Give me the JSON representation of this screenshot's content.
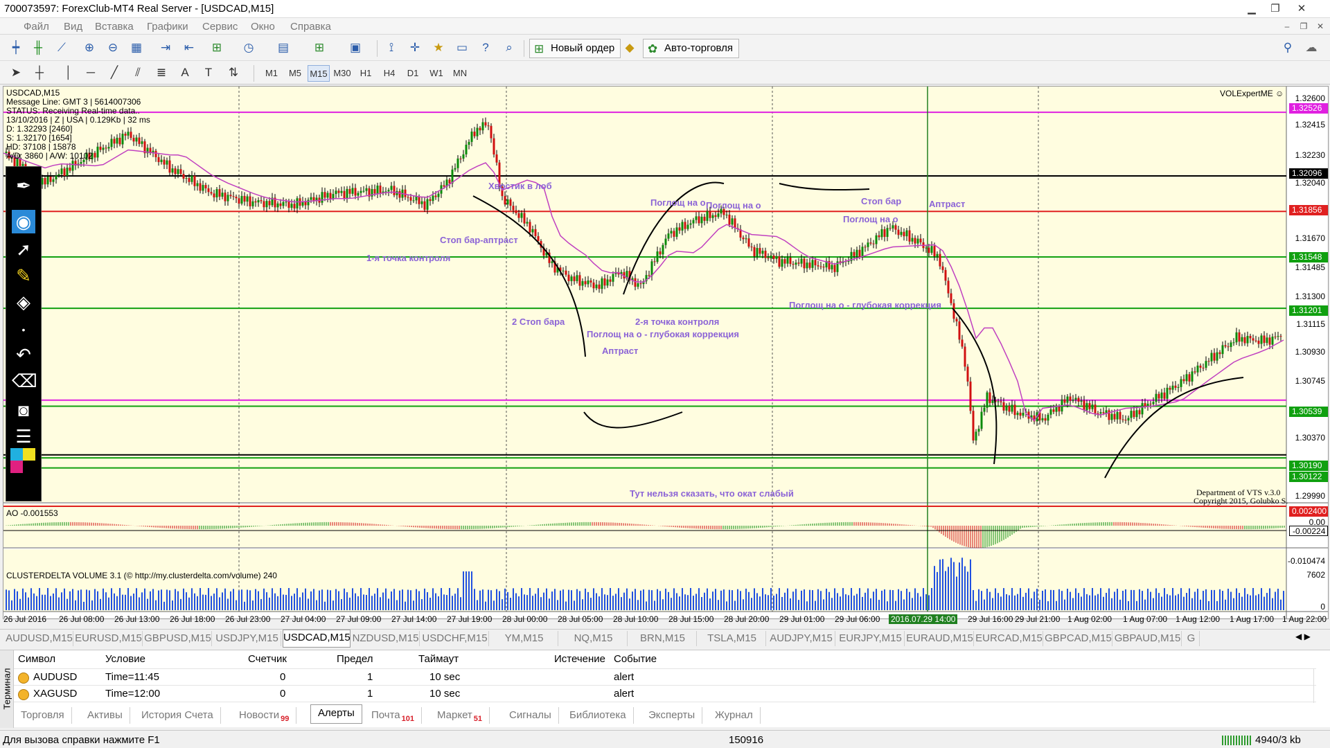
{
  "window": {
    "title": "700073597: ForexClub-MT4 Real Server - [USDCAD,M15]"
  },
  "menu": [
    "Файл",
    "Вид",
    "Вставка",
    "Графики",
    "Сервис",
    "Окно",
    "Справка"
  ],
  "toolbar": {
    "new_order": "Новый ордер",
    "auto_trading": "Авто-торговля"
  },
  "timeframes": [
    "M1",
    "M5",
    "M15",
    "M30",
    "H1",
    "H4",
    "D1",
    "W1",
    "MN"
  ],
  "active_timeframe": "M15",
  "chart": {
    "symbol_line": "USDCAD,M15",
    "message_line": "Message Line: GMT 3  |  5614007306",
    "status_line": "STATUS:  Receiving Real-time data..",
    "info_line": "13/10/2016 | Z | USA | 0.129Kb | 32 ms",
    "d_line": "D: 1.32293  [2460]",
    "s_line": "S: 1.32170  [1654]",
    "hd_line": "HD: 37108 | 15878",
    "ad_line": "A/D: 3860 | A/W: 10102",
    "indicator_title": "VOLExpertME ☺",
    "ao_label": "AO -0.001553",
    "cluster_label": "CLUSTERDELTA VOLUME 3.1 (© http://my.clusterdelta.com/volume) 240",
    "copyright_line1": "Department of VTS  v.3.0",
    "copyright_line2": "Copyright 2015, Golubko S.",
    "price_scale": [
      "1.32600",
      "1.32415",
      "1.32230",
      "1.32040",
      "1.31670",
      "1.31485",
      "1.31300",
      "1.31115",
      "1.30930",
      "1.30745",
      "1.30370",
      "1.29990"
    ],
    "price_tags": [
      {
        "value": "1.32526",
        "color": "#e020e0"
      },
      {
        "value": "1.32096",
        "color": "#000000"
      },
      {
        "value": "1.31856",
        "color": "#e02020"
      },
      {
        "value": "1.31548",
        "color": "#10a010"
      },
      {
        "value": "1.31201",
        "color": "#10a010"
      },
      {
        "value": "1.30539",
        "color": "#10a010"
      },
      {
        "value": "1.30190",
        "color": "#10a010"
      },
      {
        "value": "1.30122",
        "color": "#10a010"
      }
    ],
    "ao_scale": [
      "0.002400",
      "0.00",
      "-0.00224",
      "-0.010474"
    ],
    "cluster_scale": [
      "7602",
      "0"
    ],
    "time_axis": [
      "26 Jul 2016",
      "26 Jul 08:00",
      "26 Jul 13:00",
      "26 Jul 18:00",
      "26 Jul 23:00",
      "27 Jul 04:00",
      "27 Jul 09:00",
      "27 Jul 14:00",
      "27 Jul 19:00",
      "28 Jul 00:00",
      "28 Jul 05:00",
      "28 Jul 10:00",
      "28 Jul 15:00",
      "28 Jul 20:00",
      "29 Jul 01:00",
      "29 Jul 06:00",
      "2016.07.29 14:00",
      "29 Jul 16:00",
      "29 Jul 21:00",
      "1 Aug 02:00",
      "1 Aug 07:00",
      "1 Aug 12:00",
      "1 Aug 17:00",
      "1 Aug 22:00"
    ],
    "annotations": [
      "Хвостик в лоб",
      "Стоп бар-аптраст",
      "1-я точка контроля",
      "2 Стоп бара",
      "2-я точка контроля",
      "Поглощ на о - глубокая коррекция",
      "Аптраст",
      "Поглощ на о",
      "Поглощ на о",
      "Стоп бар",
      "Поглощ на о",
      "Аптраст",
      "Поглощ на о - глубокая коррекция",
      "Тут нельзя сказать, что окат слабый"
    ]
  },
  "symbol_tabs": [
    "AUDUSD,M15",
    "EURUSD,M15",
    "GBPUSD,M15",
    "USDJPY,M15",
    "USDCAD,M15",
    "NZDUSD,M15",
    "USDCHF,M15",
    "YM,M15",
    "NQ,M15",
    "BRN,M15",
    "TSLA,M15",
    "AUDJPY,M15",
    "EURJPY,M15",
    "EURAUD,M15",
    "EURCAD,M15",
    "GBPCAD,M15",
    "GBPAUD,M15",
    "G"
  ],
  "active_symbol_tab": "USDCAD,M15",
  "terminal": {
    "side_label": "Терминал",
    "columns": [
      "Символ",
      "Условие",
      "Счетчик",
      "Предел",
      "Таймаут",
      "Истечение",
      "Событие"
    ],
    "rows": [
      {
        "symbol": "AUDUSD",
        "condition": "Time=11:45",
        "counter": "0",
        "limit": "1",
        "timeout": "10 sec",
        "expiry": "",
        "event": "alert"
      },
      {
        "symbol": "XAGUSD",
        "condition": "Time=12:00",
        "counter": "0",
        "limit": "1",
        "timeout": "10 sec",
        "expiry": "",
        "event": "alert"
      }
    ],
    "tabs": [
      {
        "label": "Торговля",
        "badge": ""
      },
      {
        "label": "Активы",
        "badge": ""
      },
      {
        "label": "История Счета",
        "badge": ""
      },
      {
        "label": "Новости",
        "badge": "99"
      },
      {
        "label": "Алерты",
        "badge": ""
      },
      {
        "label": "Почта",
        "badge": "101"
      },
      {
        "label": "Маркет",
        "badge": "51"
      },
      {
        "label": "Сигналы",
        "badge": ""
      },
      {
        "label": "Библиотека",
        "badge": ""
      },
      {
        "label": "Эксперты",
        "badge": ""
      },
      {
        "label": "Журнал",
        "badge": ""
      }
    ],
    "active_tab": "Алерты"
  },
  "status": {
    "help": "Для вызова справки нажмите F1",
    "bars": "150916",
    "traffic": "4940/3 kb"
  }
}
